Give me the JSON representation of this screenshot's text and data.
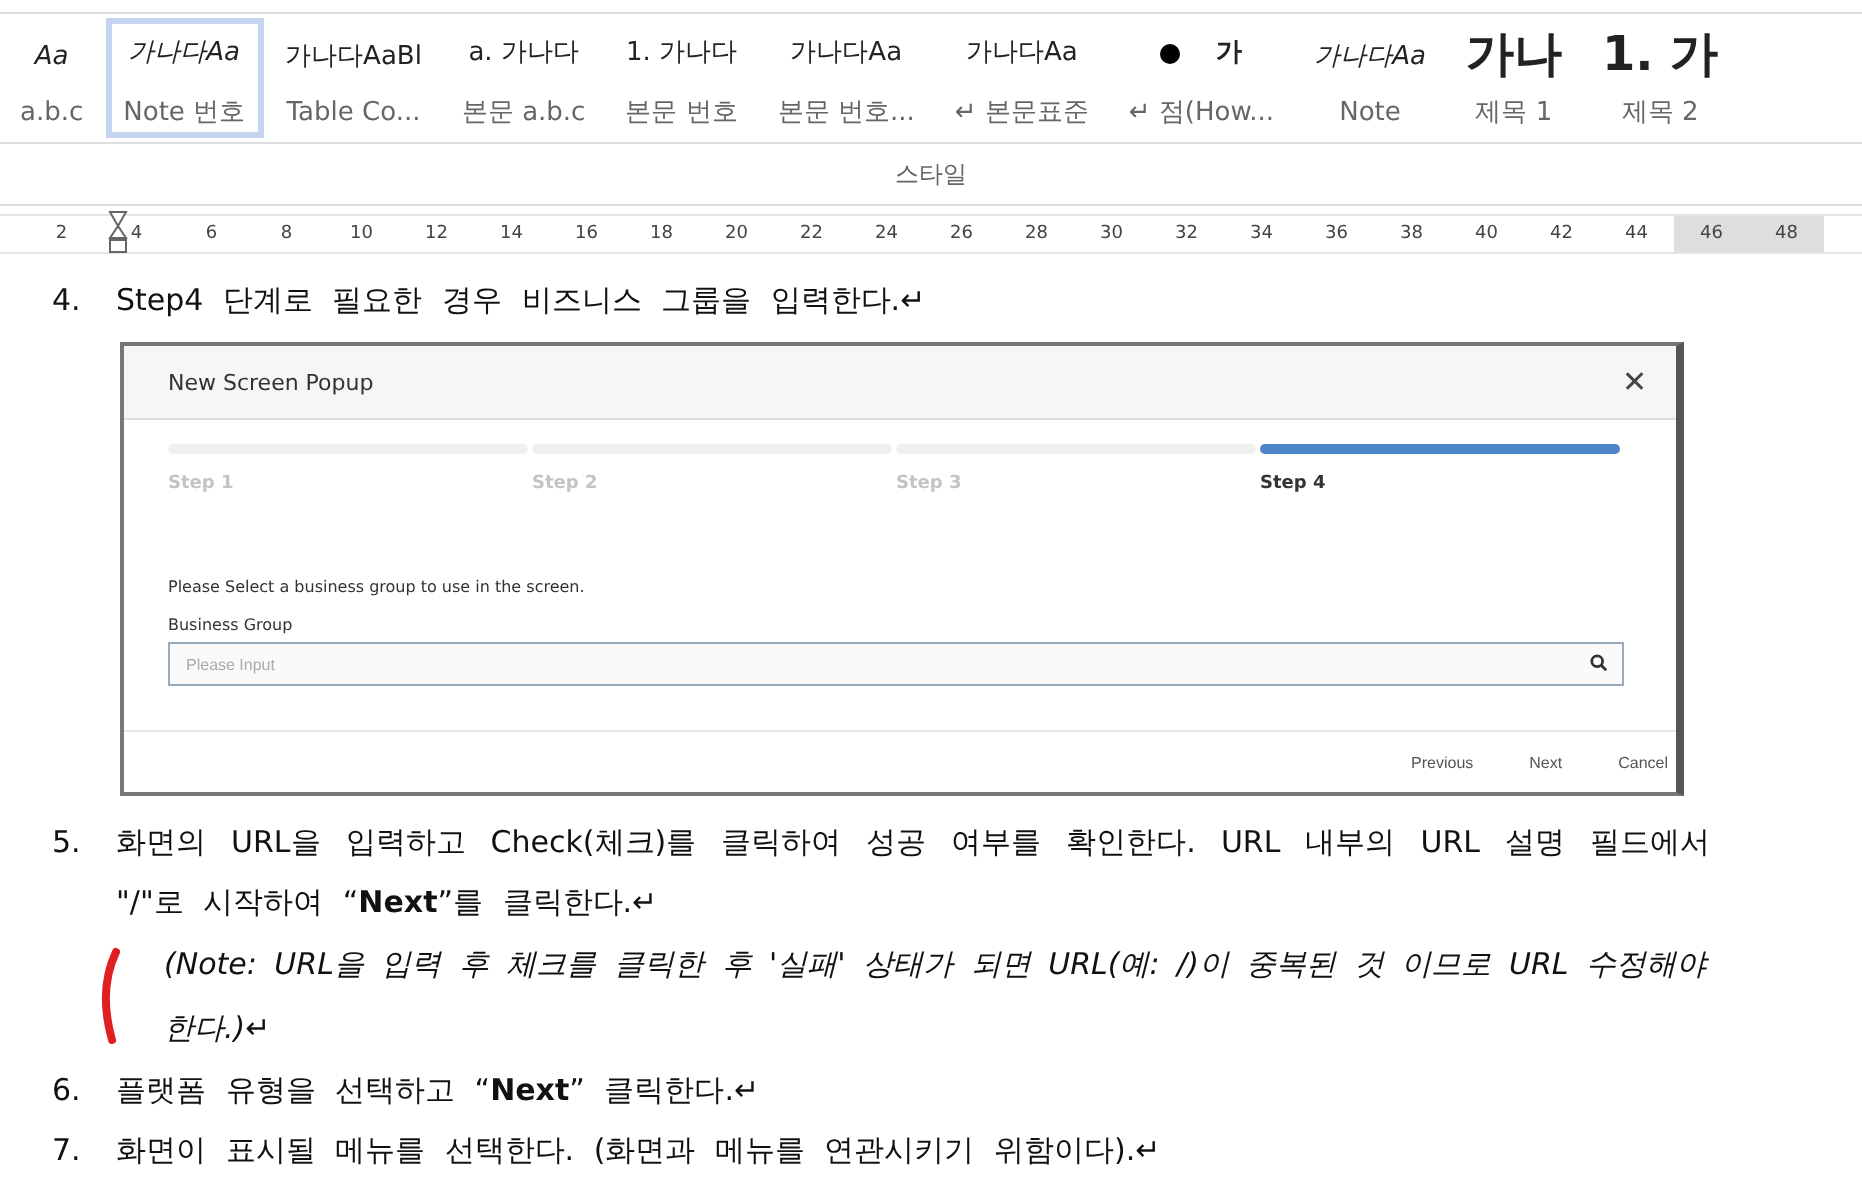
{
  "style_gallery": {
    "items": [
      {
        "preview": "Aa",
        "label": "a.b.c",
        "kind": "italic",
        "selected": false
      },
      {
        "preview": "가나다Aa",
        "label": "Note 번호",
        "kind": "italic",
        "selected": true
      },
      {
        "preview": "가나다AaBl",
        "label": "Table Co...",
        "kind": "plain",
        "selected": false
      },
      {
        "preview": "a. 가나다",
        "label": "본문 a.b.c",
        "kind": "plain",
        "selected": false
      },
      {
        "preview": "1. 가나다",
        "label": "본문 번호",
        "kind": "plain",
        "selected": false
      },
      {
        "preview": "가나다Aa",
        "label": "본문 번호...",
        "kind": "plain",
        "selected": false
      },
      {
        "preview": "가나다Aa",
        "label": "↵ 본문표준",
        "kind": "plain",
        "selected": false
      },
      {
        "preview": "가",
        "label": "↵ 점(How...",
        "kind": "bullet",
        "selected": false
      },
      {
        "preview": "가나다Aa",
        "label": "Note",
        "kind": "italic",
        "selected": false
      },
      {
        "preview": "가나",
        "label": "제목 1",
        "kind": "heading",
        "selected": false
      },
      {
        "preview": "1. 가",
        "label": "제목 2",
        "kind": "heading",
        "selected": false
      }
    ],
    "group_label": "스타일"
  },
  "ruler": {
    "labels": [
      "2",
      "4",
      "6",
      "8",
      "10",
      "12",
      "14",
      "16",
      "18",
      "20",
      "22",
      "24",
      "26",
      "28",
      "30",
      "32",
      "34",
      "36",
      "38",
      "40",
      "42",
      "44",
      "46",
      "48"
    ]
  },
  "document": {
    "steps": [
      {
        "number": "4.",
        "kind": "text",
        "text": "Step4 단계로 필요한 경우 비즈니스 그룹을 입력한다.↵"
      },
      {
        "kind": "popup"
      },
      {
        "number": "5.",
        "kind": "text",
        "text": "화면의 URL을 입력하고 Check(체크)를 클릭하여 성공 여부를 확인한다. URL 내부의 URL 설명 필드에서 \"/\"로 시작하여 “**Next**”를 클릭한다.↵"
      },
      {
        "kind": "note",
        "text": "(Note: URL을 입력 후 체크를 클릭한 후 '실패' 상태가 되면 URL(예: /)이 중복된 것 이므로 URL 수정해야 한다.)↵"
      },
      {
        "number": "6.",
        "kind": "text",
        "text": "플랫폼 유형을 선택하고 “**Next**” 클릭한다.↵"
      },
      {
        "number": "7.",
        "kind": "text",
        "text": "화면이 표시될 메뉴를 선택한다. (화면과 메뉴를 연관시키기 위함이다).↵"
      }
    ]
  },
  "popup": {
    "title": "New Screen Popup",
    "close": "✕",
    "steps": [
      {
        "label": "Step 1",
        "selected": false
      },
      {
        "label": "Step 2",
        "selected": false
      },
      {
        "label": "Step 3",
        "selected": false
      },
      {
        "label": "Step 4",
        "selected": true
      }
    ],
    "message": "Please Select a business group to use in the screen.",
    "field_label": "Business Group",
    "placeholder": "Please Input",
    "buttons": [
      "Previous",
      "Next",
      "Cancel"
    ]
  }
}
